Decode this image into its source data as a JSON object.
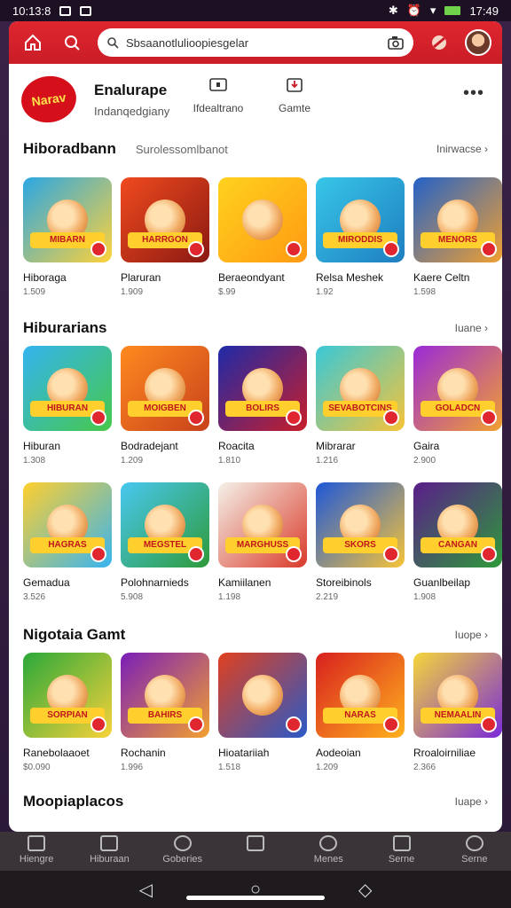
{
  "statusbar": {
    "left_time": "10:13:8",
    "right_time": "17:49"
  },
  "search": {
    "placeholder": "Sbsaanotlulioopiesgelar"
  },
  "profile": {
    "logo_text": "Narav",
    "title": "Enalurape",
    "subtitle": "Indanqedgiany",
    "buttons": [
      {
        "label": "Ifdealtrano"
      },
      {
        "label": "Gamte"
      }
    ],
    "more": "•••"
  },
  "sections": [
    {
      "title": "Hiboradbann",
      "subtitle": "Surolessomlbanot",
      "more": "Inirwacse ›",
      "items": [
        {
          "name": "Hiboraga",
          "sub": "1.509",
          "banner": "MIBARN",
          "c1": "#2aa7e4",
          "c2": "#ffd23a"
        },
        {
          "name": "Plaruran",
          "sub": "1.909",
          "banner": "HARRGON",
          "c1": "#f04a1e",
          "c2": "#8a1a12"
        },
        {
          "name": "Beraeondyant",
          "sub": "$.99",
          "banner": "",
          "c1": "#ffd21e",
          "c2": "#ff9a12"
        },
        {
          "name": "Relsa Meshek",
          "sub": "1.92",
          "banner": "MIRODDIS",
          "c1": "#38c6e8",
          "c2": "#1e7ec0"
        },
        {
          "name": "Kaere Celtn",
          "sub": "1.598",
          "banner": "MENORS",
          "c1": "#2462c8",
          "c2": "#f2a030"
        }
      ]
    },
    {
      "title": "Hiburarians",
      "subtitle": "",
      "more": "Iuane ›",
      "items": [
        {
          "name": "Hiburan",
          "sub": "1.308",
          "banner": "HIBURAN",
          "c1": "#34b4f0",
          "c2": "#47c84a"
        },
        {
          "name": "Bodradejant",
          "sub": "1.209",
          "banner": "MOIGBEN",
          "c1": "#ff8a1e",
          "c2": "#c8421c"
        },
        {
          "name": "Roacita",
          "sub": "1.810",
          "banner": "BOLIRS",
          "c1": "#1e2aa8",
          "c2": "#c81e2a"
        },
        {
          "name": "Mibrarar",
          "sub": "1.216",
          "banner": "SEVABOTCINS",
          "c1": "#38c8d8",
          "c2": "#f7c438"
        },
        {
          "name": "Gaira",
          "sub": "2.900",
          "banner": "GOLADCN",
          "c1": "#9a2ad8",
          "c2": "#f2a030"
        }
      ]
    },
    {
      "title": "",
      "subtitle": "",
      "more": "",
      "items": [
        {
          "name": "Gemadua",
          "sub": "3.526",
          "banner": "HAGRAS",
          "c1": "#ffcf2e",
          "c2": "#38b4f0"
        },
        {
          "name": "Polohnarnieds",
          "sub": "5.908",
          "banner": "MEGSTEL",
          "c1": "#48c8f0",
          "c2": "#2e9a3a"
        },
        {
          "name": "Kamiilanen",
          "sub": "1.198",
          "banner": "MARGHUSS",
          "c1": "#f5f1e8",
          "c2": "#d93a2a"
        },
        {
          "name": "Storeibinols",
          "sub": "2.219",
          "banner": "SKORS",
          "c1": "#1e58d8",
          "c2": "#f7c438"
        },
        {
          "name": "Guanlbeilap",
          "sub": "1.908",
          "banner": "CANGAN",
          "c1": "#5a1e8a",
          "c2": "#2e9a3a"
        }
      ]
    },
    {
      "title": "Nigotaia Gamt",
      "subtitle": "",
      "more": "Iuope ›",
      "items": [
        {
          "name": "Ranebolaaoet",
          "sub": "$0.090",
          "banner": "SORPIAN",
          "c1": "#2aa83a",
          "c2": "#f7d23a"
        },
        {
          "name": "Rochanin",
          "sub": "1.996",
          "banner": "BAHIRS",
          "c1": "#7a1eb8",
          "c2": "#f2a030"
        },
        {
          "name": "Hioatariiah",
          "sub": "1.518",
          "banner": "",
          "c1": "#e0401e",
          "c2": "#2a5ac8"
        },
        {
          "name": "Aodeoian",
          "sub": "1.209",
          "banner": "NARAS",
          "c1": "#d8201e",
          "c2": "#ffb21e"
        },
        {
          "name": "Rroaloirniliae",
          "sub": "2.366",
          "banner": "NEMAALIN",
          "c1": "#f5d63a",
          "c2": "#7a2ad8"
        }
      ]
    },
    {
      "title": "Moopiaplacos",
      "subtitle": "",
      "more": "Iuape ›",
      "items": []
    }
  ],
  "navbar": [
    {
      "label": "Hiengre"
    },
    {
      "label": "Hiburaan"
    },
    {
      "label": "Goberies"
    },
    {
      "label": ""
    },
    {
      "label": "Menes"
    },
    {
      "label": "Serne"
    },
    {
      "label": "Serne"
    }
  ],
  "sysbar": {
    "back": "◁",
    "home": "○",
    "recents": "◇"
  },
  "colors": {
    "accent": "#e0262f",
    "background": "#2a1838"
  }
}
